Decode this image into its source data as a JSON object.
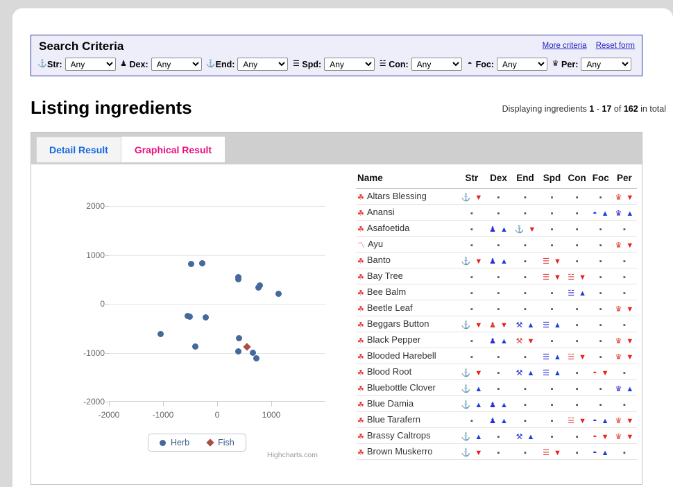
{
  "criteria": {
    "title": "Search Criteria",
    "more_criteria": "More criteria",
    "reset_form": "Reset form",
    "fields": [
      {
        "icon": "anchor-icon",
        "glyph": "⚓",
        "label": "Str:",
        "value": "Any"
      },
      {
        "icon": "pawn-icon",
        "glyph": "♟",
        "label": "Dex:",
        "value": "Any"
      },
      {
        "icon": "anchor-icon",
        "glyph": "⚓",
        "label": "End:",
        "value": "Any"
      },
      {
        "icon": "trigram-icon",
        "glyph": "☰",
        "label": "Spd:",
        "value": "Any"
      },
      {
        "icon": "trigram-icon",
        "glyph": "☱",
        "label": "Con:",
        "value": "Any"
      },
      {
        "icon": "moon-icon",
        "glyph": "◓",
        "label": "Foc:",
        "value": "Any"
      },
      {
        "icon": "crown-icon",
        "glyph": "♛",
        "label": "Per:",
        "value": "Any"
      }
    ],
    "options": [
      "Any"
    ]
  },
  "page": {
    "title": "Listing ingredients",
    "displaying_prefix": "Displaying ingredients",
    "range_start": "1",
    "range_dash": "-",
    "range_end": "17",
    "of": "of",
    "total": "162",
    "in_total": "in total"
  },
  "tabs": [
    {
      "label": "Detail Result",
      "active": false
    },
    {
      "label": "Graphical Result",
      "active": true
    }
  ],
  "chart_data": {
    "type": "scatter",
    "title": "",
    "xlabel": "",
    "ylabel": "",
    "xlim": [
      -2000,
      2000
    ],
    "ylim": [
      -2000,
      2000
    ],
    "xticks": [
      -2000,
      -1000,
      0,
      1000
    ],
    "yticks": [
      -2000,
      -1000,
      0,
      1000,
      2000
    ],
    "grid": true,
    "legend_position": "bottom",
    "credit": "Highcharts.com",
    "series": [
      {
        "name": "Herb",
        "color": "#45699b",
        "marker": "circle",
        "points": [
          [
            -480,
            820
          ],
          [
            -270,
            830
          ],
          [
            390,
            540
          ],
          [
            395,
            500
          ],
          [
            790,
            380
          ],
          [
            760,
            330
          ],
          [
            1140,
            210
          ],
          [
            -540,
            -250
          ],
          [
            -510,
            -260
          ],
          [
            -210,
            -270
          ],
          [
            -1050,
            -620
          ],
          [
            -410,
            -870
          ],
          [
            400,
            -700
          ],
          [
            390,
            -975
          ],
          [
            660,
            -1000
          ],
          [
            730,
            -1115
          ]
        ]
      },
      {
        "name": "Fish",
        "color": "#ab4c48",
        "marker": "diamond",
        "points": [
          [
            550,
            -880
          ]
        ]
      }
    ]
  },
  "table": {
    "columns": [
      "Name",
      "Str",
      "Dex",
      "End",
      "Spd",
      "Con",
      "Foc",
      "Per"
    ],
    "rows": [
      {
        "name": "Altars Blessing",
        "name_glyph": "☘",
        "stats": [
          {
            "glyph": "⚓",
            "dir": "down"
          },
          {
            "dir": "none"
          },
          {
            "dir": "none"
          },
          {
            "dir": "none"
          },
          {
            "dir": "none"
          },
          {
            "dir": "none"
          },
          {
            "glyph": "♛",
            "dir": "down"
          }
        ]
      },
      {
        "name": "Anansi",
        "name_glyph": "☘",
        "stats": [
          {
            "dir": "none"
          },
          {
            "dir": "none"
          },
          {
            "dir": "none"
          },
          {
            "dir": "none"
          },
          {
            "dir": "none"
          },
          {
            "glyph": "◓",
            "dir": "up"
          },
          {
            "glyph": "♛",
            "dir": "up"
          }
        ]
      },
      {
        "name": "Asafoetida",
        "name_glyph": "☘",
        "stats": [
          {
            "dir": "none"
          },
          {
            "glyph": "♟",
            "dir": "up"
          },
          {
            "glyph": "⚓",
            "dir": "down"
          },
          {
            "dir": "none"
          },
          {
            "dir": "none"
          },
          {
            "dir": "none"
          },
          {
            "dir": "none"
          }
        ]
      },
      {
        "name": "Ayu",
        "name_glyph": "〽",
        "stats": [
          {
            "dir": "none"
          },
          {
            "dir": "none"
          },
          {
            "dir": "none"
          },
          {
            "dir": "none"
          },
          {
            "dir": "none"
          },
          {
            "dir": "none"
          },
          {
            "glyph": "♛",
            "dir": "down"
          }
        ]
      },
      {
        "name": "Banto",
        "name_glyph": "☘",
        "stats": [
          {
            "glyph": "⚓",
            "dir": "down"
          },
          {
            "glyph": "♟",
            "dir": "up"
          },
          {
            "dir": "none"
          },
          {
            "glyph": "☰",
            "dir": "down"
          },
          {
            "dir": "none"
          },
          {
            "dir": "none"
          },
          {
            "dir": "none"
          }
        ]
      },
      {
        "name": "Bay Tree",
        "name_glyph": "☘",
        "stats": [
          {
            "dir": "none"
          },
          {
            "dir": "none"
          },
          {
            "dir": "none"
          },
          {
            "glyph": "☰",
            "dir": "down"
          },
          {
            "glyph": "☱",
            "dir": "down"
          },
          {
            "dir": "none"
          },
          {
            "dir": "none"
          }
        ]
      },
      {
        "name": "Bee Balm",
        "name_glyph": "☘",
        "stats": [
          {
            "dir": "none"
          },
          {
            "dir": "none"
          },
          {
            "dir": "none"
          },
          {
            "dir": "none"
          },
          {
            "glyph": "☱",
            "dir": "up"
          },
          {
            "dir": "none"
          },
          {
            "dir": "none"
          }
        ]
      },
      {
        "name": "Beetle Leaf",
        "name_glyph": "☘",
        "stats": [
          {
            "dir": "none"
          },
          {
            "dir": "none"
          },
          {
            "dir": "none"
          },
          {
            "dir": "none"
          },
          {
            "dir": "none"
          },
          {
            "dir": "none"
          },
          {
            "glyph": "♛",
            "dir": "down"
          }
        ]
      },
      {
        "name": "Beggars Button",
        "name_glyph": "☘",
        "stats": [
          {
            "glyph": "⚓",
            "dir": "down"
          },
          {
            "glyph": "♟",
            "dir": "down"
          },
          {
            "glyph": "⚒",
            "dir": "up"
          },
          {
            "glyph": "☰",
            "dir": "up"
          },
          {
            "dir": "none"
          },
          {
            "dir": "none"
          },
          {
            "dir": "none"
          }
        ]
      },
      {
        "name": "Black Pepper",
        "name_glyph": "☘",
        "stats": [
          {
            "dir": "none"
          },
          {
            "glyph": "♟",
            "dir": "up"
          },
          {
            "glyph": "⚒",
            "dir": "down"
          },
          {
            "dir": "none"
          },
          {
            "dir": "none"
          },
          {
            "dir": "none"
          },
          {
            "glyph": "♛",
            "dir": "down"
          }
        ]
      },
      {
        "name": "Blooded Harebell",
        "name_glyph": "☘",
        "stats": [
          {
            "dir": "none"
          },
          {
            "dir": "none"
          },
          {
            "dir": "none"
          },
          {
            "glyph": "☰",
            "dir": "up"
          },
          {
            "glyph": "☱",
            "dir": "down"
          },
          {
            "dir": "none"
          },
          {
            "glyph": "♛",
            "dir": "down"
          }
        ]
      },
      {
        "name": "Blood Root",
        "name_glyph": "☘",
        "stats": [
          {
            "glyph": "⚓",
            "dir": "down"
          },
          {
            "dir": "none"
          },
          {
            "glyph": "⚒",
            "dir": "up"
          },
          {
            "glyph": "☰",
            "dir": "up"
          },
          {
            "dir": "none"
          },
          {
            "glyph": "◓",
            "dir": "down"
          },
          {
            "dir": "none"
          }
        ]
      },
      {
        "name": "Bluebottle Clover",
        "name_glyph": "☘",
        "stats": [
          {
            "glyph": "⚓",
            "dir": "up"
          },
          {
            "dir": "none"
          },
          {
            "dir": "none"
          },
          {
            "dir": "none"
          },
          {
            "dir": "none"
          },
          {
            "dir": "none"
          },
          {
            "glyph": "♛",
            "dir": "up"
          }
        ]
      },
      {
        "name": "Blue Damia",
        "name_glyph": "☘",
        "stats": [
          {
            "glyph": "⚓",
            "dir": "up"
          },
          {
            "glyph": "♟",
            "dir": "up"
          },
          {
            "dir": "none"
          },
          {
            "dir": "none"
          },
          {
            "dir": "none"
          },
          {
            "dir": "none"
          },
          {
            "dir": "none"
          }
        ]
      },
      {
        "name": "Blue Tarafern",
        "name_glyph": "☘",
        "stats": [
          {
            "dir": "none"
          },
          {
            "glyph": "♟",
            "dir": "up"
          },
          {
            "dir": "none"
          },
          {
            "dir": "none"
          },
          {
            "glyph": "☱",
            "dir": "down"
          },
          {
            "glyph": "◓",
            "dir": "up"
          },
          {
            "glyph": "♛",
            "dir": "down"
          }
        ]
      },
      {
        "name": "Brassy Caltrops",
        "name_glyph": "☘",
        "stats": [
          {
            "glyph": "⚓",
            "dir": "up"
          },
          {
            "dir": "none"
          },
          {
            "glyph": "⚒",
            "dir": "up"
          },
          {
            "dir": "none"
          },
          {
            "dir": "none"
          },
          {
            "glyph": "◓",
            "dir": "down"
          },
          {
            "glyph": "♛",
            "dir": "down"
          }
        ]
      },
      {
        "name": "Brown Muskerro",
        "name_glyph": "☘",
        "stats": [
          {
            "glyph": "⚓",
            "dir": "down"
          },
          {
            "dir": "none"
          },
          {
            "dir": "none"
          },
          {
            "glyph": "☰",
            "dir": "down"
          },
          {
            "dir": "none"
          },
          {
            "glyph": "◓",
            "dir": "up"
          },
          {
            "dir": "none"
          }
        ]
      }
    ]
  },
  "colors": {
    "accent_active_tab": "#ee0e7e",
    "accent_inactive_tab": "#1569e0",
    "link": "#2222bb",
    "criteria_border": "#2b33a0",
    "criteria_bg": "#eeeefb",
    "herb": "#45699b",
    "fish": "#ab4c48",
    "up": "#1b3fd8",
    "down": "#e8211a"
  }
}
